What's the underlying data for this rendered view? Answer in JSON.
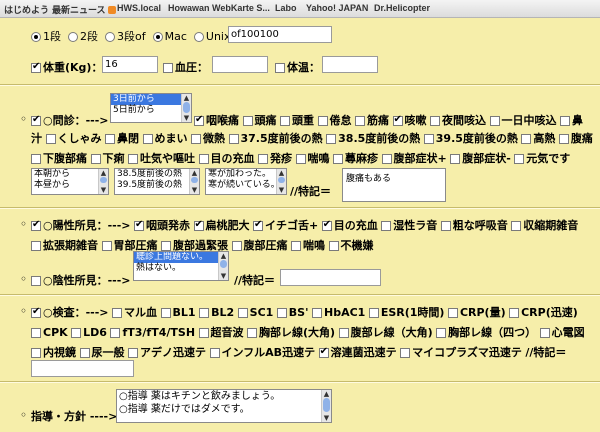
{
  "bookmarks": [
    {
      "label": "はじめよう"
    },
    {
      "label": "最新ニュース"
    },
    {
      "label": "HWS.local"
    },
    {
      "label": "Howawan WebKarte S..."
    },
    {
      "label": "Labo"
    },
    {
      "label": "Yahoo! JAPAN"
    },
    {
      "label": "Dr.Helicopter"
    }
  ],
  "mode": {
    "options": [
      "1段",
      "2段",
      "3段of",
      "Mac",
      "Unix"
    ],
    "selected": "Mac",
    "unix_value": "of100100"
  },
  "vitals": {
    "weight_label": "体重(Kg)：",
    "weight_value": "16",
    "bp_label": "血圧：",
    "bp_value": "",
    "temp_label": "体温：",
    "temp_value": ""
  },
  "monshin": {
    "label": "○問診：--->",
    "onset_options": [
      "3日前から",
      "5日前から"
    ],
    "items": [
      {
        "label": "咽喉痛",
        "checked": true
      },
      {
        "label": "頭痛",
        "checked": false
      },
      {
        "label": "頭重",
        "checked": false
      },
      {
        "label": "倦怠",
        "checked": false
      },
      {
        "label": "筋痛",
        "checked": false
      },
      {
        "label": "咳嗽",
        "checked": true
      },
      {
        "label": "夜間咳込",
        "checked": false
      },
      {
        "label": "一日中咳込",
        "checked": false
      },
      {
        "label": "鼻汁",
        "checked": false
      },
      {
        "label": "くしゃみ",
        "checked": false
      },
      {
        "label": "鼻閉",
        "checked": false
      },
      {
        "label": "めまい",
        "checked": false
      },
      {
        "label": "微熱",
        "checked": false
      },
      {
        "label": "37.5度前後の熱",
        "checked": false
      },
      {
        "label": "38.5度前後の熱",
        "checked": false
      },
      {
        "label": "39.5度前後の熱",
        "checked": false
      },
      {
        "label": "高熱",
        "checked": false
      },
      {
        "label": "腹痛",
        "checked": false
      },
      {
        "label": "下腹部痛",
        "checked": false
      },
      {
        "label": "下痢",
        "checked": false
      },
      {
        "label": "吐気や嘔吐",
        "checked": false
      },
      {
        "label": "目の充血",
        "checked": false
      },
      {
        "label": "発疹",
        "checked": false
      },
      {
        "label": "喘鳴",
        "checked": false
      },
      {
        "label": "蕁麻疹",
        "checked": false
      },
      {
        "label": "腹部症状+",
        "checked": false
      },
      {
        "label": "腹部症状-",
        "checked": false
      },
      {
        "label": "元気です",
        "checked": false
      }
    ],
    "list1": [
      "本朝から",
      "本昼から"
    ],
    "list2": [
      "38.5度前後の熱",
      "39.5度前後の熱"
    ],
    "list3": [
      "寒が加わった。",
      "寒が続いている。"
    ],
    "special_label": "//特記＝",
    "special_value": "腹痛もある"
  },
  "positive": {
    "label": "○陽性所見：--->",
    "items": [
      {
        "label": "咽頭発赤",
        "checked": true
      },
      {
        "label": "扁桃肥大",
        "checked": true
      },
      {
        "label": "イチゴ舌+",
        "checked": true
      },
      {
        "label": "目の充血",
        "checked": true
      },
      {
        "label": "湿性ラ音",
        "checked": false
      },
      {
        "label": "粗な呼吸音",
        "checked": false
      },
      {
        "label": "収縮期雑音",
        "checked": false
      },
      {
        "label": "拡張期雑音",
        "checked": false
      },
      {
        "label": "胃部圧痛",
        "checked": false
      },
      {
        "label": "腹部過緊張",
        "checked": false
      },
      {
        "label": "腹部圧痛",
        "checked": false
      },
      {
        "label": "喘鳴",
        "checked": false
      },
      {
        "label": "不機嫌",
        "checked": false
      }
    ]
  },
  "negative": {
    "label": "○陰性所見：--->",
    "options": [
      "聴診上問題ない。",
      "熱はない。"
    ],
    "special_label": "//特記＝",
    "special_value": ""
  },
  "exam": {
    "label": "○検査：--->",
    "items": [
      {
        "label": "マル血",
        "checked": false
      },
      {
        "label": "BL1",
        "checked": false
      },
      {
        "label": "BL2",
        "checked": false
      },
      {
        "label": "SC1",
        "checked": false
      },
      {
        "label": "BS'",
        "checked": false
      },
      {
        "label": "HbAC1",
        "checked": false
      },
      {
        "label": "ESR(1時間)",
        "checked": false
      },
      {
        "label": "CRP(量)",
        "checked": false
      },
      {
        "label": "CRP(迅速)",
        "checked": false
      },
      {
        "label": "CPK",
        "checked": false
      },
      {
        "label": "LD6",
        "checked": false
      },
      {
        "label": "fT3/fT4/TSH",
        "checked": false
      },
      {
        "label": "超音波",
        "checked": false
      },
      {
        "label": "胸部レ線(大角)",
        "checked": false
      },
      {
        "label": "腹部レ線（大角)",
        "checked": false
      },
      {
        "label": "胸部レ線（四つ）",
        "checked": false
      },
      {
        "label": "心電図",
        "checked": false
      },
      {
        "label": "内視鏡",
        "checked": false
      },
      {
        "label": "尿一般",
        "checked": false
      },
      {
        "label": "アデノ迅速テ",
        "checked": false
      },
      {
        "label": "インフルAB迅速テ",
        "checked": false
      },
      {
        "label": "溶連菌迅速テ",
        "checked": true
      },
      {
        "label": "マイコプラズマ迅速テ",
        "checked": false
      }
    ],
    "special_label": "//特記＝",
    "special_value": ""
  },
  "guidance": {
    "label": "指導・方針 ---->",
    "options": [
      "○指導 薬はキチンと飲みましょう。",
      "○指導 薬だけではダメです。"
    ]
  }
}
